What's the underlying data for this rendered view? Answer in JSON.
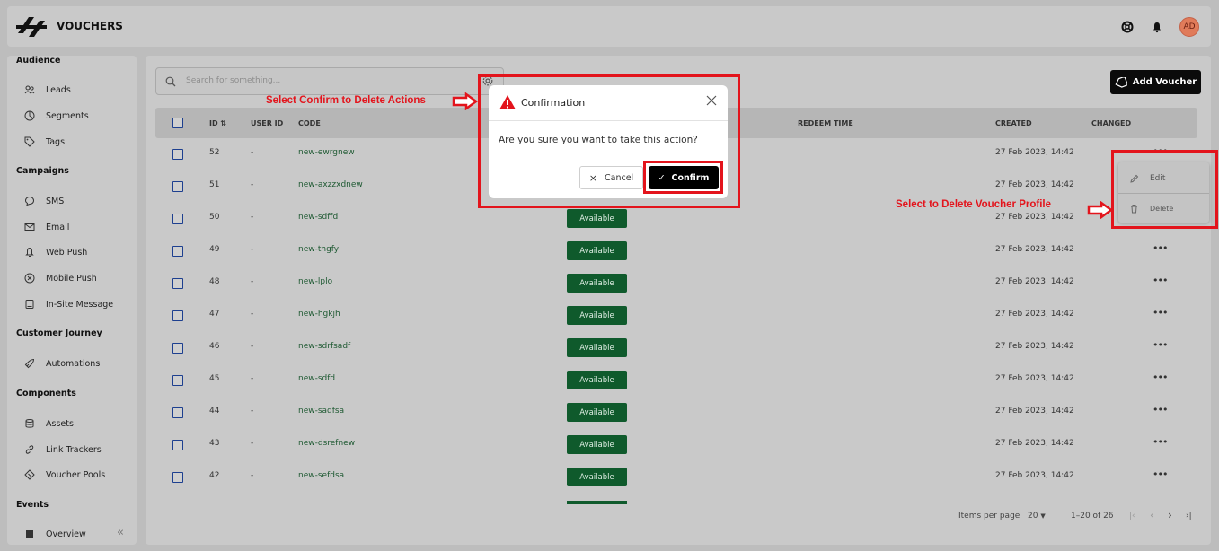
{
  "header": {
    "title": "VOUCHERS",
    "avatar_initials": "AD"
  },
  "sidebar": {
    "sections": [
      {
        "title": "Audience",
        "items": [
          "Leads",
          "Segments",
          "Tags"
        ]
      },
      {
        "title": "Campaigns",
        "items": [
          "SMS",
          "Email",
          "Web Push",
          "Mobile Push",
          "In-Site Message"
        ]
      },
      {
        "title": "Customer Journey",
        "items": [
          "Automations"
        ]
      },
      {
        "title": "Components",
        "items": [
          "Assets",
          "Link Trackers",
          "Voucher Pools"
        ]
      },
      {
        "title": "Events",
        "items": [
          "Overview"
        ]
      }
    ],
    "collapse_glyph": "«"
  },
  "toolbar": {
    "search_placeholder": "Search for something...",
    "add_voucher_label": "Add Voucher"
  },
  "table": {
    "columns": {
      "id": "ID",
      "user_id": "USER ID",
      "code": "CODE",
      "redeem_time": "REDEEM TIME",
      "created": "CREATED",
      "changed": "CHANGED"
    },
    "rows": [
      {
        "id": "52",
        "user_id": "-",
        "code": "new-ewrgnew",
        "status": "",
        "created": "27 Feb 2023, 14:42"
      },
      {
        "id": "51",
        "user_id": "-",
        "code": "new-axzzxdnew",
        "status": "",
        "created": "27 Feb 2023, 14:42"
      },
      {
        "id": "50",
        "user_id": "-",
        "code": "new-sdffd",
        "status": "Available",
        "created": "27 Feb 2023, 14:42"
      },
      {
        "id": "49",
        "user_id": "-",
        "code": "new-thgfy",
        "status": "Available",
        "created": "27 Feb 2023, 14:42"
      },
      {
        "id": "48",
        "user_id": "-",
        "code": "new-lplo",
        "status": "Available",
        "created": "27 Feb 2023, 14:42"
      },
      {
        "id": "47",
        "user_id": "-",
        "code": "new-hgkjh",
        "status": "Available",
        "created": "27 Feb 2023, 14:42"
      },
      {
        "id": "46",
        "user_id": "-",
        "code": "new-sdrfsadf",
        "status": "Available",
        "created": "27 Feb 2023, 14:42"
      },
      {
        "id": "45",
        "user_id": "-",
        "code": "new-sdfd",
        "status": "Available",
        "created": "27 Feb 2023, 14:42"
      },
      {
        "id": "44",
        "user_id": "-",
        "code": "new-sadfsa",
        "status": "Available",
        "created": "27 Feb 2023, 14:42"
      },
      {
        "id": "43",
        "user_id": "-",
        "code": "new-dsrefnew",
        "status": "Available",
        "created": "27 Feb 2023, 14:42"
      },
      {
        "id": "42",
        "user_id": "-",
        "code": "new-sefdsa",
        "status": "Available",
        "created": "27 Feb 2023, 14:42"
      }
    ],
    "row_action_glyph": "•••"
  },
  "pagination": {
    "items_per_page_label": "Items per page",
    "items_per_page_value": "20",
    "range": "1–20 of 26"
  },
  "context_menu": {
    "edit_label": "Edit",
    "delete_label": "Delete"
  },
  "modal": {
    "title": "Confirmation",
    "message": "Are you sure you want to take this action?",
    "cancel_label": "Cancel",
    "confirm_label": "Confirm"
  },
  "annotations": {
    "confirm_note": "Select Confirm to Delete Actions",
    "delete_note": "Select to Delete Voucher Profile"
  },
  "colors": {
    "annotation_red": "#e3141c",
    "available_badge": "#0f5a2c",
    "primary_button": "#0b0b0b",
    "avatar": "#e07b5a"
  }
}
